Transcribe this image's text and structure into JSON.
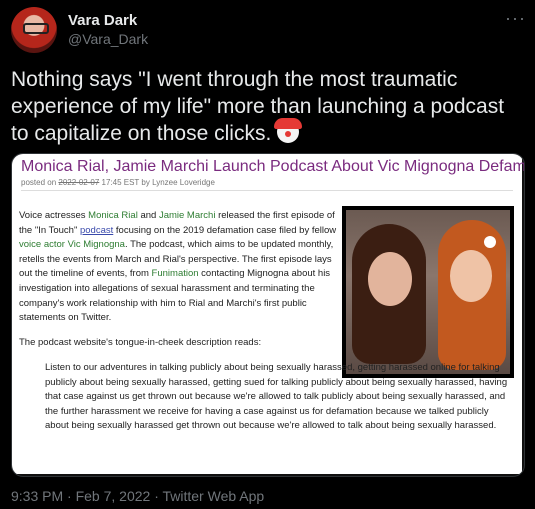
{
  "author": {
    "name": "Vara Dark",
    "handle": "@Vara_Dark"
  },
  "menu_icon": "more-horizontal-icon",
  "tweet": {
    "text": "Nothing says \"I went through the most traumatic experience of my life\" more than launching a podcast to capitalize on those clicks.",
    "emoji": "clown-face-icon"
  },
  "article": {
    "title": "Monica Rial, Jamie Marchi Launch Podcast About Vic Mignogna Defamation Case",
    "meta_prefix": "posted on ",
    "meta_date": "2022-02-07",
    "meta_suffix": " 17:45 EST by Lynzee Loveridge",
    "p1_a": "Voice actresses ",
    "p1_link1": "Monica Rial",
    "p1_b": " and ",
    "p1_link2": "Jamie Marchi",
    "p1_c": " released the first episode of the \"In Touch\" ",
    "p1_link3": "podcast",
    "p1_d": " focusing on the 2019 defamation case filed by fellow ",
    "p1_link4": "voice actor Vic Mignogna",
    "p1_e": ". The podcast, which aims to be updated monthly, retells the events from March and Rial's perspective. The first episode lays out the timeline of events, from ",
    "p1_link5": "Funimation",
    "p1_f": " contacting Mignogna about his investigation into allegations of sexual harassment and terminating the company's work relationship with him to Rial and Marchi's first public statements on Twitter.",
    "caption": "The podcast website's tongue-in-cheek description reads:",
    "quote": "Listen to our adventures in talking publicly about being sexually harassed, getting harassed online for talking publicly about being sexually harassed, getting sued for talking publicly about being sexually harassed, having that case against us get thrown out because we're allowed to talk publicly about being sexually harassed, and the further harassment we receive for having a case against us for defamation because we talked publicly about being sexually harassed get thrown out because we're allowed to talk about being sexually harassed."
  },
  "footer": "9:33 PM · Feb 7, 2022 · Twitter Web App"
}
